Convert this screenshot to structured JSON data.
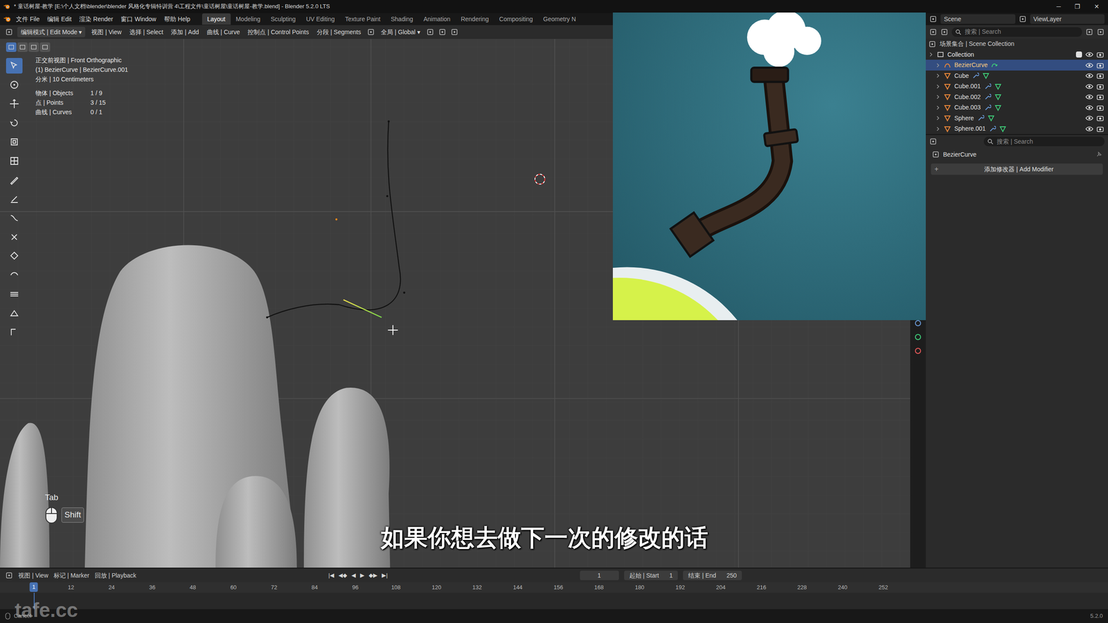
{
  "window": {
    "title": "* 童话树屋-教学 [E:\\个人文档\\blender\\blender 风格化专辑特训营 4\\工程文件\\童话树屋\\童话树屋-教学.blend] - Blender 5.2.0 LTS",
    "controls": [
      "─",
      "❐",
      "✕"
    ]
  },
  "menu": [
    "文件 File",
    "编辑 Edit",
    "渲染 Render",
    "窗口 Window",
    "帮助 Help"
  ],
  "workspaces": [
    {
      "label": "Layout",
      "selected": true
    },
    {
      "label": "Modeling",
      "selected": false
    },
    {
      "label": "Sculpting",
      "selected": false
    },
    {
      "label": "UV Editing",
      "selected": false
    },
    {
      "label": "Texture Paint",
      "selected": false
    },
    {
      "label": "Shading",
      "selected": false
    },
    {
      "label": "Animation",
      "selected": false
    },
    {
      "label": "Rendering",
      "selected": false
    },
    {
      "label": "Compositing",
      "selected": false
    },
    {
      "label": "Geometry N",
      "selected": false
    }
  ],
  "scene": "Scene",
  "view_layer": "ViewLayer",
  "viewport_header": {
    "mode": "编辑模式 | Edit Mode",
    "menus": [
      "视图 | View",
      "选择 | Select",
      "添加 | Add",
      "曲线 | Curve",
      "控制点 | Control Points",
      "分段 | Segments"
    ],
    "orientation": "全局 | Global"
  },
  "select_modes": [
    {
      "selected": true
    },
    {
      "selected": false
    },
    {
      "selected": false
    },
    {
      "selected": false
    }
  ],
  "tools": [
    {
      "selected": true
    },
    {
      "selected": false
    },
    {
      "selected": false
    },
    {
      "selected": false
    },
    {
      "selected": false
    },
    {
      "selected": false
    },
    {
      "selected": false
    },
    {
      "selected": false
    },
    {
      "selected": false
    },
    {
      "selected": false
    },
    {
      "selected": false
    },
    {
      "selected": false
    },
    {
      "selected": false
    },
    {
      "selected": false
    },
    {
      "selected": false
    }
  ],
  "viewport": {
    "info": [
      "正交前视图 | Front Orthographic",
      "(1) BezierCurve | BezierCurve.001",
      "分米 | 10 Centimeters"
    ],
    "stats": [
      {
        "label": "物体 | Objects",
        "value": "1 / 9"
      },
      {
        "label": "点 | Points",
        "value": "3 / 15"
      },
      {
        "label": "曲线 | Curves",
        "value": "0 / 1"
      }
    ],
    "key": "Tab",
    "modifier_key": "Shift",
    "subtitle": "如果你想去做下一次的修改的话"
  },
  "outliner": {
    "search_placeholder": "搜索 | Search",
    "root": "场景集合 | Scene Collection",
    "collection": "Collection",
    "items": [
      {
        "name": "BezierCurve",
        "kind": "curve",
        "selected": true
      },
      {
        "name": "Cube",
        "kind": "mesh",
        "selected": false
      },
      {
        "name": "Cube.001",
        "kind": "mesh",
        "selected": false
      },
      {
        "name": "Cube.002",
        "kind": "mesh",
        "selected": false
      },
      {
        "name": "Cube.003",
        "kind": "mesh",
        "selected": false
      },
      {
        "name": "Sphere",
        "kind": "mesh",
        "selected": false
      },
      {
        "name": "Sphere.001",
        "kind": "mesh",
        "selected": false
      }
    ]
  },
  "properties": {
    "search_placeholder": "搜索 | Search",
    "object": "BezierCurve",
    "add_modifier": "添加修改器 | Add Modifier"
  },
  "timeline": {
    "menus": [
      "视图 | View",
      "标记 | Marker",
      "回放 | Playback"
    ],
    "transport": [
      "|◀",
      "◀◆",
      "◀",
      "▶",
      "◆▶",
      "▶|"
    ],
    "current_frame": "1",
    "start_label": "起始 | Start",
    "start": "1",
    "end_label": "结束 | End",
    "end": "250",
    "marker": "1",
    "ticks": [
      "12",
      "24",
      "36",
      "48",
      "60",
      "72",
      "84",
      "96",
      "108",
      "120",
      "132",
      "144",
      "156",
      "168",
      "180",
      "192",
      "204",
      "216",
      "228",
      "240",
      "252"
    ]
  },
  "status": {
    "hint": "Cancel",
    "version": "5.2.0"
  },
  "watermark": "tafe.cc"
}
